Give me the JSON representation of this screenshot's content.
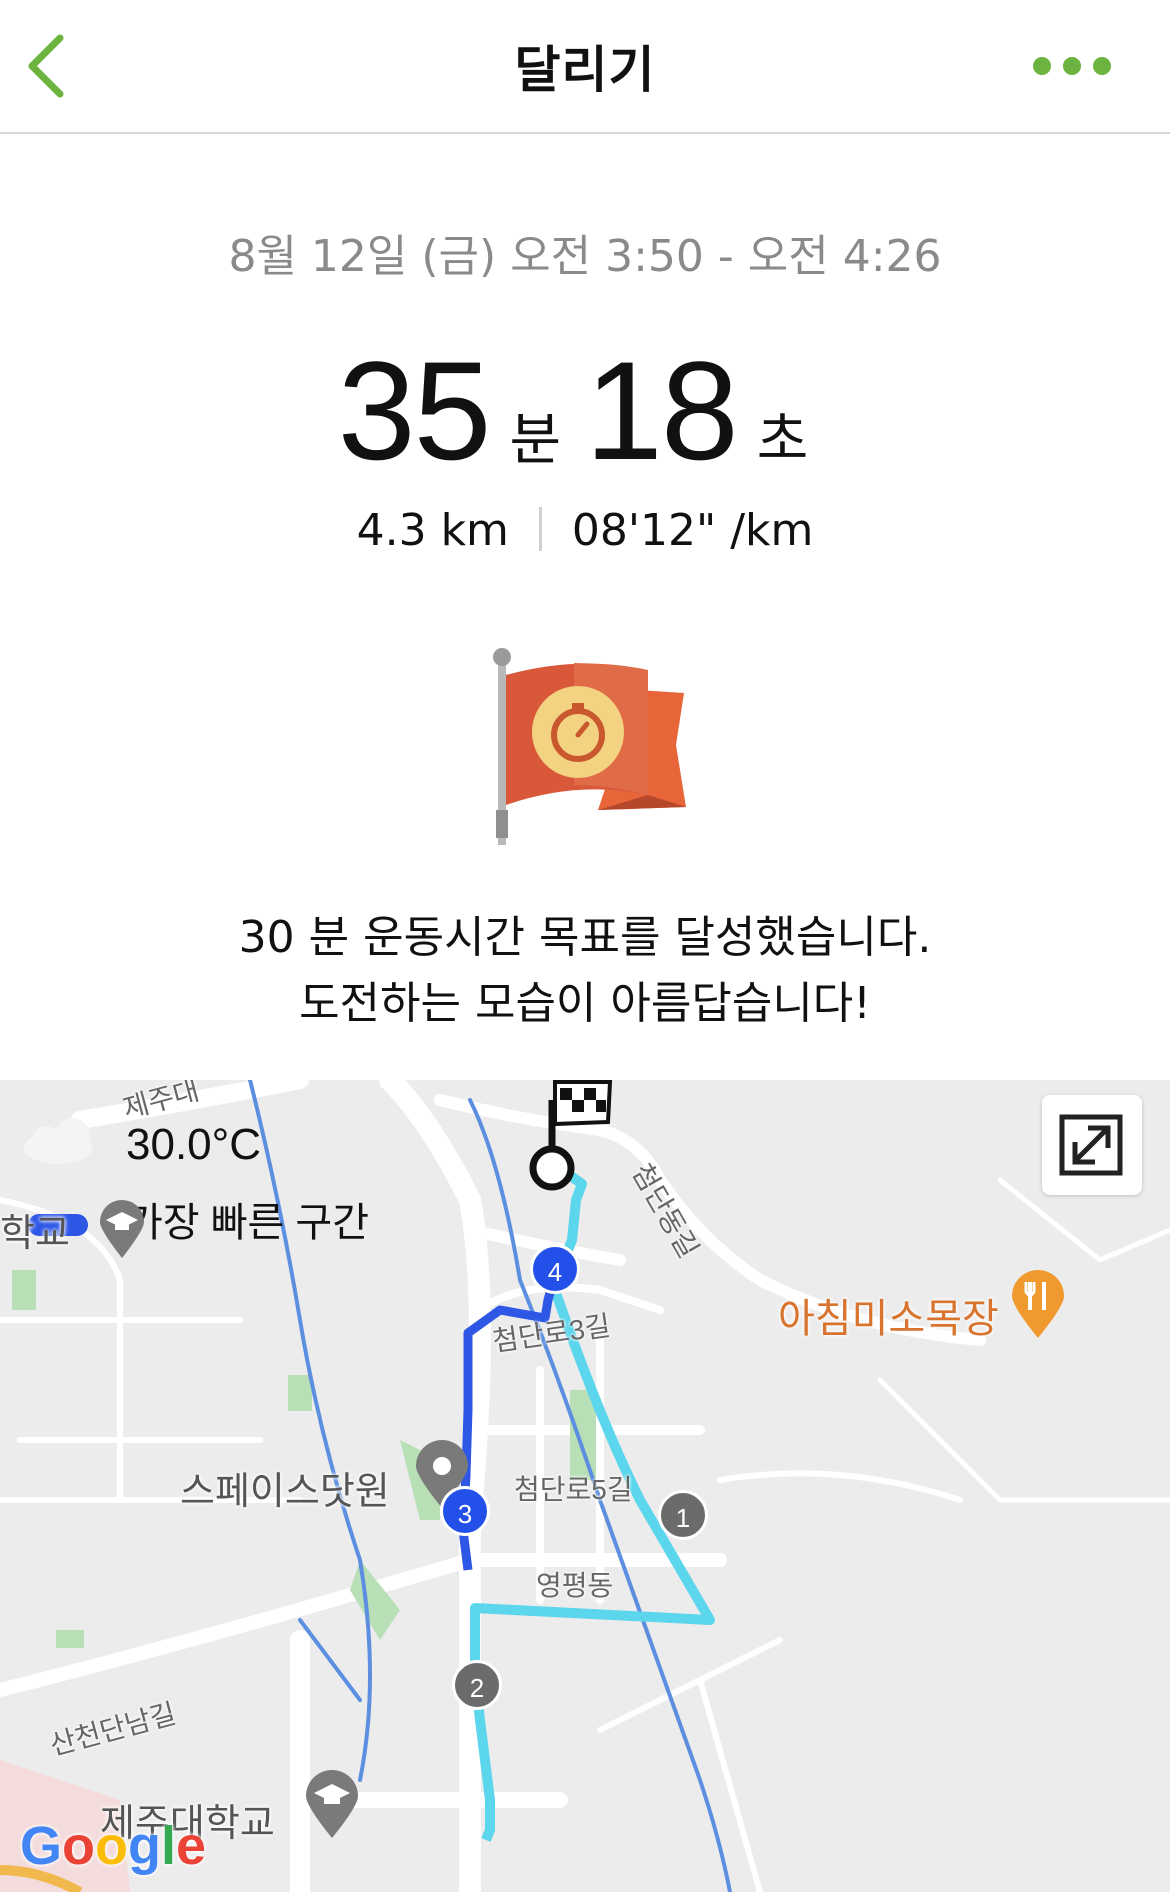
{
  "nav": {
    "title": "달리기",
    "accent_color": "#6db33f",
    "back_icon": "chevron-left-icon",
    "more_icon": "more-dots-icon"
  },
  "summary": {
    "date_range": "8월 12일 (금) 오전 3:50 - 오전 4:26",
    "duration_minutes": "35",
    "duration_minutes_unit": "분",
    "duration_seconds": "18",
    "duration_seconds_unit": "초",
    "distance": "4.3 km",
    "pace": "08'12\" /km"
  },
  "goal": {
    "badge_icon": "stopwatch-flag-icon",
    "message_line1": "30 분 운동시간 목표를 달성했습니다.",
    "message_line2": "도전하는 모습이 아름답습니다!"
  },
  "map": {
    "temperature": "30.0°C",
    "fastest_segment_label": "가장 빠른 구간",
    "fastest_color": "#2e57e6",
    "route_color": "#5cd6ec",
    "places": {
      "spacedot": "스페이스닷원",
      "breakfast_ranch": "아침미소목장",
      "jeju_univ": "제주대학교",
      "school_partial": "학교",
      "jeju_partial": "제주대"
    },
    "roads": {
      "cheomdan3": "첨단로3길",
      "cheomdan5": "첨단로5길",
      "cheomdandong": "첨단동길",
      "yeongpyeong": "영평동",
      "sancheondan": "산천단남길"
    },
    "markers": [
      "4",
      "3",
      "1",
      "2"
    ],
    "google_logo": "Google"
  }
}
